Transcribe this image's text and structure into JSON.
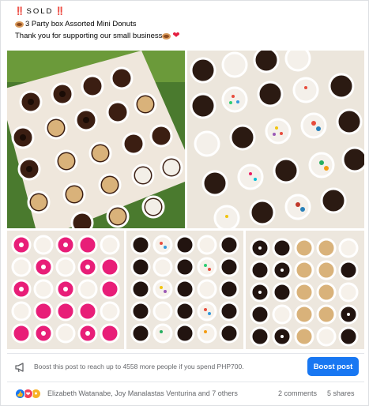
{
  "post": {
    "sold_marks_left": "‼️",
    "sold_word": "SOLD",
    "sold_marks_right": "‼️",
    "line2": "3 Party box Assorted Mini Donuts",
    "line3": "Thank you for supporting our small business"
  },
  "photos": [
    {
      "name": "photo-1-almond-choco-donuts"
    },
    {
      "name": "photo-2-sprinkle-candy-donuts"
    },
    {
      "name": "photo-3-pink-donuts"
    },
    {
      "name": "photo-4-mixed-donuts"
    },
    {
      "name": "photo-5-cookies-cream-donuts"
    }
  ],
  "boost": {
    "text": "Boost this post to reach up to 4558 more people if you spend PHP700.",
    "button_label": "Boost post",
    "button_color": "#1877f2"
  },
  "engagement": {
    "reactors": "Elizabeth Watanabe, Joy Manalastas Venturina and 7 others",
    "comments": "2 comments",
    "shares": "5 shares"
  },
  "icons": [
    "donut-icon",
    "heart-icon",
    "megaphone-icon",
    "like-icon",
    "love-icon",
    "wow-icon"
  ]
}
